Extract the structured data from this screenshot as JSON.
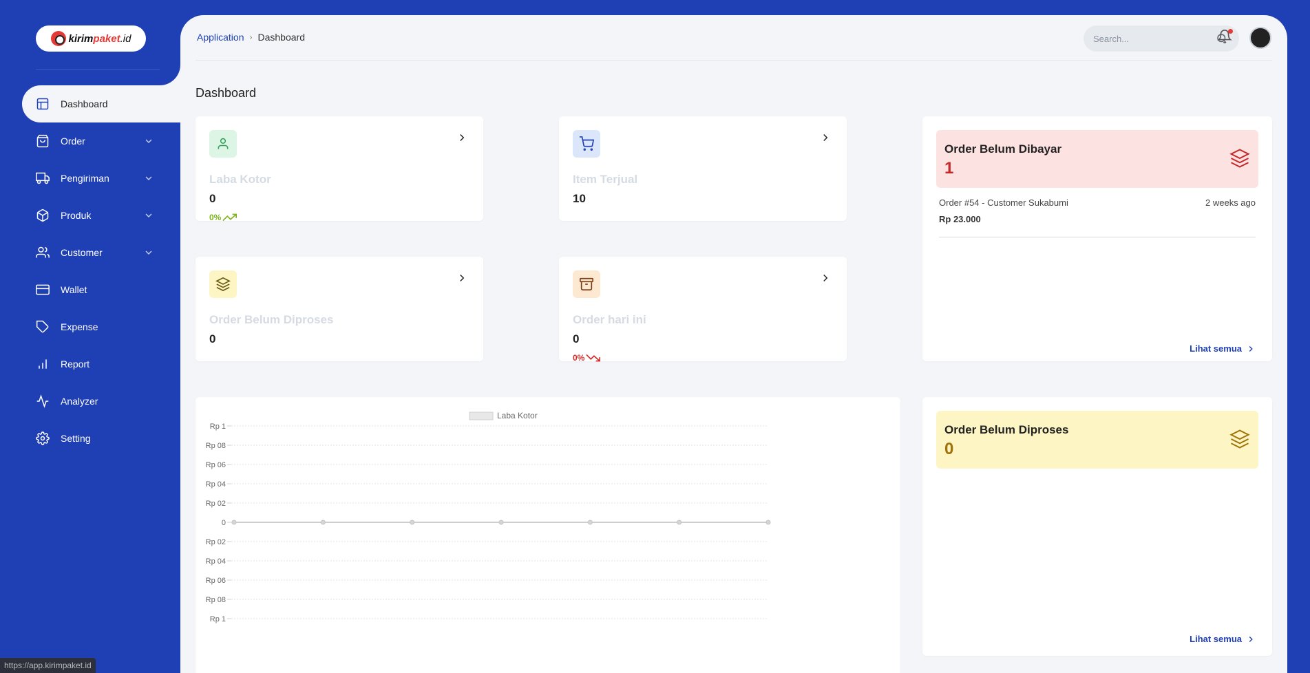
{
  "sidebar": {
    "logo": {
      "prefix": "kirim",
      "accent": "paket",
      "suffix": ".id"
    },
    "items": [
      {
        "label": "Dashboard",
        "icon": "layout-icon",
        "expandable": false,
        "active": true
      },
      {
        "label": "Order",
        "icon": "shopping-bag-icon",
        "expandable": true
      },
      {
        "label": "Pengiriman",
        "icon": "truck-icon",
        "expandable": true
      },
      {
        "label": "Produk",
        "icon": "box-icon",
        "expandable": true
      },
      {
        "label": "Customer",
        "icon": "users-icon",
        "expandable": true
      },
      {
        "label": "Wallet",
        "icon": "credit-card-icon",
        "expandable": false
      },
      {
        "label": "Expense",
        "icon": "tag-icon",
        "expandable": false
      },
      {
        "label": "Report",
        "icon": "bar-chart-icon",
        "expandable": false
      },
      {
        "label": "Analyzer",
        "icon": "activity-icon",
        "expandable": false
      },
      {
        "label": "Setting",
        "icon": "gear-icon",
        "expandable": false
      }
    ]
  },
  "status_url": "https://app.kirimpaket.id",
  "header": {
    "breadcrumb": {
      "root": "Application",
      "current": "Dashboard"
    },
    "search": {
      "placeholder": "Search...",
      "value": ""
    }
  },
  "page_title": "Dashboard",
  "stats": {
    "laba_kotor": {
      "label": "Laba Kotor",
      "value": "0",
      "trend": "0%",
      "trend_dir": "up"
    },
    "item_terjual": {
      "label": "Item Terjual",
      "value": "10"
    },
    "order_belum_diproses": {
      "label": "Order Belum Diproses",
      "value": "0"
    },
    "order_hari_ini": {
      "label": "Order hari ini",
      "value": "0",
      "trend": "0%",
      "trend_dir": "down"
    }
  },
  "unpaid_orders": {
    "title": "Order Belum Dibayar",
    "count": "1",
    "orders": [
      {
        "title": "Order #54 - Customer Sukabumi",
        "time": "2 weeks ago",
        "price": "Rp 23.000"
      }
    ],
    "see_all": "Lihat semua"
  },
  "unprocessed_orders": {
    "title": "Order Belum Diproses",
    "count": "0",
    "see_all": "Lihat semua"
  },
  "colors": {
    "brand": "#1f3fb4",
    "unpaid_bg": "#fde2e2",
    "unpaid_text": "#c62828",
    "unprocessed_bg": "#fdf5c4",
    "unprocessed_text": "#a07208"
  },
  "chart_data": {
    "type": "line",
    "legend": [
      "Laba Kotor"
    ],
    "legend_position": "top",
    "y_tick_labels": [
      "Rp 1",
      "Rp 08",
      "Rp 06",
      "Rp 04",
      "Rp 02",
      "0",
      "Rp 02",
      "Rp 04",
      "Rp 06",
      "Rp 08",
      "Rp 1"
    ],
    "y_tick_values": [
      1,
      0.8,
      0.6,
      0.4,
      0.2,
      0,
      -0.2,
      -0.4,
      -0.6,
      -0.8,
      -1
    ],
    "ylim": [
      -1,
      1
    ],
    "series": [
      {
        "name": "Laba Kotor",
        "values": [
          0,
          0,
          0,
          0,
          0,
          0,
          0
        ]
      }
    ],
    "grid": true
  }
}
